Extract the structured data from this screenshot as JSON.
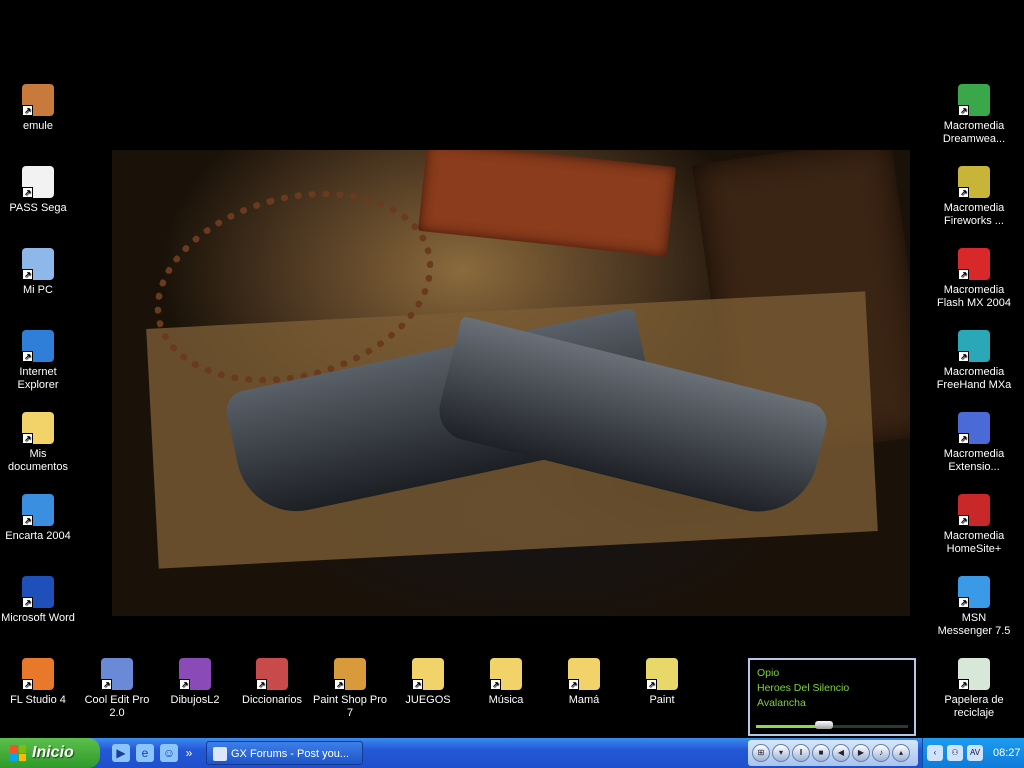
{
  "desktop": {
    "left_icons": [
      {
        "label": "emule",
        "icon": "donkey-icon",
        "color": "#c77a3c"
      },
      {
        "label": "PASS Sega",
        "icon": "text-document-icon",
        "color": "#f2f2f2"
      },
      {
        "label": "Mi PC",
        "icon": "computer-icon",
        "color": "#8fb8ea"
      },
      {
        "label": "Internet Explorer",
        "icon": "internet-explorer-icon",
        "color": "#2f7ed8"
      },
      {
        "label": "Mis documentos",
        "icon": "documents-folder-icon",
        "color": "#f1d36a"
      },
      {
        "label": "Encarta 2004",
        "icon": "encarta-icon",
        "color": "#3a8fe0"
      },
      {
        "label": "Microsoft Word",
        "icon": "word-icon",
        "color": "#1f4fb8"
      }
    ],
    "right_icons": [
      {
        "label": "Macromedia Dreamwea...",
        "icon": "dreamweaver-icon",
        "color": "#3aa84a"
      },
      {
        "label": "Macromedia Fireworks ...",
        "icon": "fireworks-icon",
        "color": "#c9b43a"
      },
      {
        "label": "Macromedia Flash MX 2004",
        "icon": "flash-icon",
        "color": "#d8282a"
      },
      {
        "label": "Macromedia FreeHand MXa",
        "icon": "freehand-icon",
        "color": "#2aa8b8"
      },
      {
        "label": "Macromedia Extensio...",
        "icon": "extension-manager-icon",
        "color": "#4a6ad8"
      },
      {
        "label": "Macromedia HomeSite+",
        "icon": "homesite-icon",
        "color": "#c82828"
      },
      {
        "label": "MSN Messenger 7.5",
        "icon": "msn-messenger-icon",
        "color": "#3a9ae8"
      }
    ],
    "bottom_icons": [
      {
        "label": "FL Studio 4",
        "icon": "fl-studio-icon",
        "color": "#e8782a"
      },
      {
        "label": "Cool Edit Pro 2.0",
        "icon": "cool-edit-icon",
        "color": "#6a8ad8"
      },
      {
        "label": "DibujosL2",
        "icon": "winrar-archive-icon",
        "color": "#8a4ab8"
      },
      {
        "label": "Diccionarios",
        "icon": "books-icon",
        "color": "#c84a4a"
      },
      {
        "label": "Paint Shop Pro 7",
        "icon": "palette-icon",
        "color": "#d89a3a"
      },
      {
        "label": "JUEGOS",
        "icon": "folder-icon",
        "color": "#f1d36a"
      },
      {
        "label": "Música",
        "icon": "folder-icon",
        "color": "#f1d36a"
      },
      {
        "label": "Mamá",
        "icon": "folder-icon",
        "color": "#f1d36a"
      },
      {
        "label": "Paint",
        "icon": "paint-brushes-icon",
        "color": "#e8d86a"
      },
      {
        "label": "Papelera de reciclaje",
        "icon": "recycle-bin-icon",
        "color": "#d8e8d8"
      }
    ]
  },
  "media_player": {
    "track_lines": [
      "Opio",
      "Heroes Del Silencio",
      "Avalancha"
    ],
    "progress": 0.45,
    "text_color": "#7dd43a"
  },
  "taskbar": {
    "start_label": "Inicio",
    "quick_launch": [
      "media-player-icon",
      "internet-explorer-icon",
      "msn-icon"
    ],
    "expand_label": "»",
    "task_label": "GX Forums - Post you...",
    "tray_time": "08:27",
    "tray_chevron": "‹"
  }
}
